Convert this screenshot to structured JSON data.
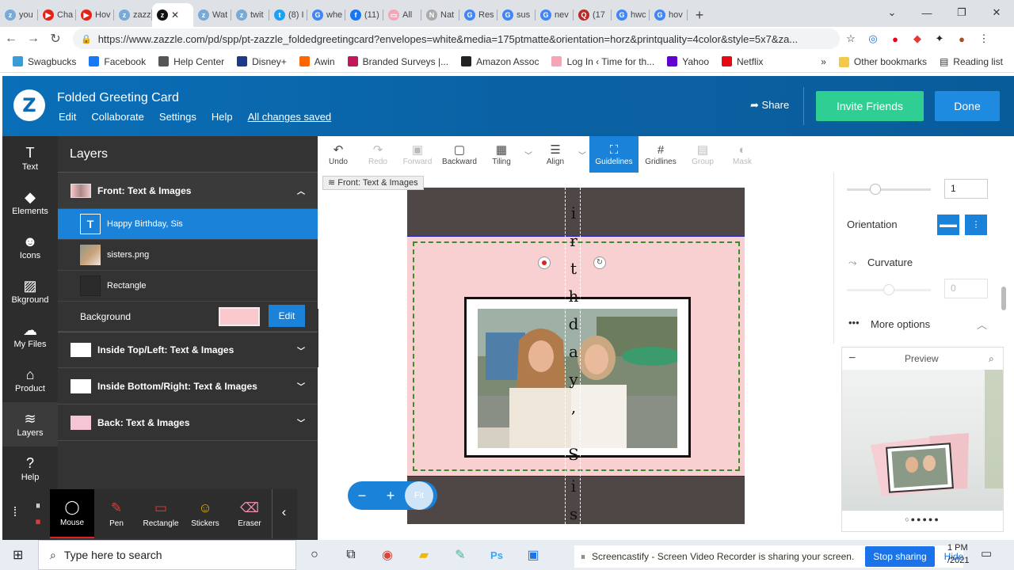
{
  "browser": {
    "tabs": [
      {
        "label": "you",
        "color": "#7aa9d6",
        "glyph": "z"
      },
      {
        "label": "Cha",
        "color": "#e62117",
        "glyph": "▶"
      },
      {
        "label": "Hov",
        "color": "#e62117",
        "glyph": "▶"
      },
      {
        "label": "zazz",
        "color": "#7aa9d6",
        "glyph": "z"
      },
      {
        "label": "",
        "color": "#111111",
        "glyph": "z",
        "active": true
      },
      {
        "label": "Wat",
        "color": "#7aa9d6",
        "glyph": "z"
      },
      {
        "label": "twit",
        "color": "#7aa9d6",
        "glyph": "z"
      },
      {
        "label": "(8) I",
        "color": "#1da1f2",
        "glyph": "t"
      },
      {
        "label": "whe",
        "color": "#4285f4",
        "glyph": "G"
      },
      {
        "label": "(11)",
        "color": "#1877f2",
        "glyph": "f"
      },
      {
        "label": "All",
        "color": "#f4a6b8",
        "glyph": "▭"
      },
      {
        "label": "Nat",
        "color": "#aaaaaa",
        "glyph": "N"
      },
      {
        "label": "Res",
        "color": "#4285f4",
        "glyph": "G"
      },
      {
        "label": "sus",
        "color": "#4285f4",
        "glyph": "G"
      },
      {
        "label": "nev",
        "color": "#4285f4",
        "glyph": "G"
      },
      {
        "label": "(17",
        "color": "#b92b27",
        "glyph": "Q"
      },
      {
        "label": "hwc",
        "color": "#4285f4",
        "glyph": "G"
      },
      {
        "label": "hov",
        "color": "#4285f4",
        "glyph": "G"
      }
    ],
    "new_tab": "+",
    "url": "https://www.zazzle.com/pd/spp/pt-zazzle_foldedgreetingcard?envelopes=white&media=175ptmatte&orientation=horz&printquality=4color&style=5x7&za...",
    "bookmarks": [
      {
        "label": "Swagbucks",
        "color": "#3b9bd8"
      },
      {
        "label": "Facebook",
        "color": "#1877f2"
      },
      {
        "label": "Help Center",
        "color": "#555555"
      },
      {
        "label": "Disney+",
        "color": "#1d3a8a"
      },
      {
        "label": "Awin",
        "color": "#ff6600"
      },
      {
        "label": "Branded Surveys |...",
        "color": "#c2185b"
      },
      {
        "label": "Amazon Assoc",
        "color": "#222222"
      },
      {
        "label": "Log In ‹ Time for th...",
        "color": "#f4a6b8"
      },
      {
        "label": "Yahoo",
        "color": "#6001d2"
      },
      {
        "label": "Netflix",
        "color": "#e50914"
      }
    ],
    "bookmarks_more": "»",
    "other_bookmarks": "Other bookmarks",
    "reading_list": "Reading list"
  },
  "app": {
    "logo": "Z",
    "title": "Folded Greeting Card",
    "menu": [
      "Edit",
      "Collaborate",
      "Settings",
      "Help"
    ],
    "saved_status": "All changes saved",
    "share": "Share",
    "invite": "Invite Friends",
    "done": "Done"
  },
  "rail": [
    {
      "label": "Text",
      "icon": "T"
    },
    {
      "label": "Elements",
      "icon": "◆"
    },
    {
      "label": "Icons",
      "icon": "☻"
    },
    {
      "label": "Bkground",
      "icon": "▨"
    },
    {
      "label": "My Files",
      "icon": "☁"
    },
    {
      "label": "Product",
      "icon": "⌂"
    },
    {
      "label": "Layers",
      "icon": "≋",
      "active": true
    },
    {
      "label": "Help",
      "icon": "?"
    }
  ],
  "layers": {
    "title": "Layers",
    "front": "Front: Text & Images",
    "items": [
      {
        "label": "Happy Birthday, Sis",
        "icon": "T",
        "selected": true
      },
      {
        "label": "sisters.png",
        "icon": "img"
      },
      {
        "label": "Rectangle",
        "icon": "rect"
      }
    ],
    "background_label": "Background",
    "background_color": "#f9c9cf",
    "edit": "Edit",
    "groups": [
      "Inside Top/Left: Text & Images",
      "Inside Bottom/Right: Text & Images",
      "Back: Text & Images"
    ]
  },
  "design_toolbar": [
    {
      "label": "Undo",
      "icon": "↶",
      "enabled": true
    },
    {
      "label": "Redo",
      "icon": "↷",
      "enabled": false
    },
    {
      "label": "Forward",
      "icon": "▣",
      "enabled": false
    },
    {
      "label": "Backward",
      "icon": "▢",
      "enabled": true
    },
    {
      "label": "Tiling",
      "icon": "▦",
      "enabled": true
    },
    {
      "label": "Align",
      "icon": "☰",
      "enabled": true
    },
    {
      "label": "Guidelines",
      "icon": "⛶",
      "enabled": true,
      "active": true
    },
    {
      "label": "Gridlines",
      "icon": "#",
      "enabled": true
    },
    {
      "label": "Group",
      "icon": "▤",
      "enabled": false
    },
    {
      "label": "Mask",
      "icon": "◐",
      "enabled": false
    }
  ],
  "breadcrumb": "Front: Text & Images",
  "canvas": {
    "vertical_text_chars": [
      "i",
      "r",
      "t",
      "h",
      "d",
      "a",
      "y",
      ",",
      "S",
      "i",
      "s"
    ]
  },
  "zoom": {
    "minus": "−",
    "plus": "+",
    "fit": "Fit"
  },
  "properties": {
    "spacing_value": "1",
    "orientation": "Orientation",
    "curvature": "Curvature",
    "curvature_value": "0",
    "more_options": "More options"
  },
  "preview": {
    "title": "Preview",
    "collapse": "−",
    "dots": "○●●●●●"
  },
  "screencastify": [
    {
      "label": "Mouse",
      "icon": "◯",
      "active": true
    },
    {
      "label": "Pen",
      "icon": "✎"
    },
    {
      "label": "Rectangle",
      "icon": "▭"
    },
    {
      "label": "Stickers",
      "icon": "☺"
    },
    {
      "label": "Eraser",
      "icon": "⌫"
    }
  ],
  "taskbar": {
    "search": "Type here to search",
    "sharing_text": "Screencastify - Screen Video Recorder is sharing your screen.",
    "stop": "Stop sharing",
    "hide": "Hide",
    "time": "1 PM",
    "date": "/2021"
  }
}
